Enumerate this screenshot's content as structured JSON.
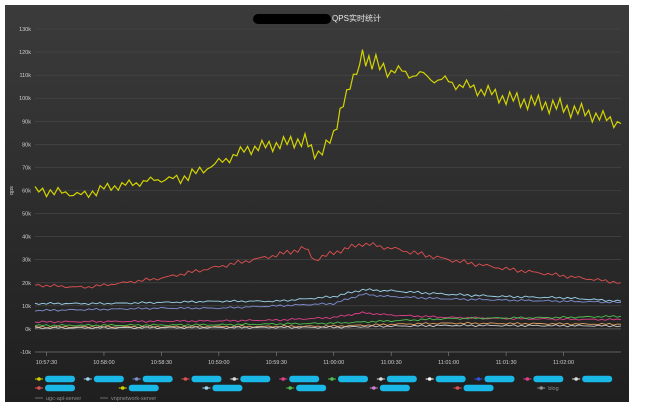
{
  "chart_data": {
    "type": "line",
    "title": "QPS实时统计",
    "ylabel": "qps",
    "ylim": [
      -10000,
      130000
    ],
    "y_ticks": [
      {
        "v": -10000,
        "label": "-10k"
      },
      {
        "v": 0,
        "label": "0k"
      },
      {
        "v": 10000,
        "label": "10k"
      },
      {
        "v": 20000,
        "label": "20k"
      },
      {
        "v": 30000,
        "label": "30k"
      },
      {
        "v": 40000,
        "label": "40k"
      },
      {
        "v": 50000,
        "label": "50k"
      },
      {
        "v": 60000,
        "label": "60k"
      },
      {
        "v": 70000,
        "label": "70k"
      },
      {
        "v": 80000,
        "label": "80k"
      },
      {
        "v": 90000,
        "label": "90k"
      },
      {
        "v": 100000,
        "label": "100k"
      },
      {
        "v": 110000,
        "label": "110k"
      },
      {
        "v": 120000,
        "label": "120k"
      },
      {
        "v": 130000,
        "label": "130k"
      }
    ],
    "x_ticks": [
      "10:57:30",
      "10:58:00",
      "10:58:30",
      "10:59:00",
      "10:59:30",
      "11:00:00",
      "11:00:30",
      "11:01:00",
      "11:01:30",
      "11:02:00"
    ],
    "xlim": [
      "10:57:24",
      "10:02:30"
    ],
    "grid": true,
    "legend": "bottom",
    "series": [
      {
        "color": "#d4d400",
        "x": [
          "10:57:24",
          "10:57:40",
          "10:57:50",
          "10:58:00",
          "10:58:15",
          "10:58:30",
          "10:58:40",
          "10:59:00",
          "10:59:15",
          "10:59:30",
          "10:59:45",
          "10:59:50",
          "11:00:00",
          "11:00:05",
          "11:00:12",
          "11:00:15",
          "11:00:20",
          "11:00:30",
          "11:00:45",
          "11:01:00",
          "11:01:15",
          "11:01:30",
          "11:01:45",
          "11:02:00",
          "11:02:15",
          "11:02:30"
        ],
        "values": [
          60000,
          59000,
          58000,
          61000,
          63000,
          65000,
          65000,
          72000,
          78000,
          80000,
          82000,
          75000,
          83000,
          100000,
          110000,
          120000,
          115000,
          112000,
          110000,
          107000,
          104000,
          100000,
          98000,
          96000,
          93000,
          89000
        ]
      },
      {
        "color": "#e05050",
        "x": [
          "10:57:24",
          "10:57:50",
          "10:58:00",
          "10:58:30",
          "10:59:00",
          "10:59:30",
          "10:59:45",
          "10:59:50",
          "11:00:00",
          "11:00:15",
          "11:00:30",
          "11:01:00",
          "11:01:30",
          "11:02:00",
          "11:02:30"
        ],
        "values": [
          19000,
          18000,
          19000,
          22000,
          27000,
          32000,
          35000,
          30000,
          33000,
          37000,
          35000,
          30000,
          26000,
          23000,
          20000
        ]
      },
      {
        "color": "#9fd6f0",
        "x": [
          "10:57:24",
          "10:58:00",
          "10:58:30",
          "10:59:00",
          "10:59:30",
          "11:00:00",
          "11:00:15",
          "11:00:30",
          "11:01:00",
          "11:01:30",
          "11:02:00",
          "11:02:30"
        ],
        "values": [
          11000,
          11000,
          11500,
          12000,
          12000,
          14000,
          17000,
          16500,
          15000,
          14000,
          13500,
          12000
        ]
      },
      {
        "color": "#7f8fd0",
        "x": [
          "10:57:24",
          "10:58:00",
          "10:58:30",
          "10:59:00",
          "10:59:30",
          "11:00:00",
          "11:00:15",
          "11:00:30",
          "11:01:00",
          "11:01:30",
          "11:02:00",
          "11:02:30"
        ],
        "values": [
          8000,
          8500,
          9000,
          9000,
          10000,
          11000,
          15000,
          14000,
          13000,
          12500,
          12000,
          11500
        ]
      },
      {
        "color": "#e0408a",
        "x": [
          "10:57:24",
          "10:58:00",
          "10:59:00",
          "10:59:30",
          "11:00:00",
          "11:00:15",
          "11:00:30",
          "11:01:00",
          "11:01:30",
          "11:02:00",
          "11:02:30"
        ],
        "values": [
          3000,
          3200,
          3500,
          3800,
          5000,
          7000,
          6000,
          5000,
          4500,
          4200,
          4000
        ]
      },
      {
        "color": "#50c050",
        "x": [
          "10:57:24",
          "10:58:00",
          "10:59:00",
          "11:00:00",
          "11:00:30",
          "11:01:00",
          "11:02:00",
          "11:02:30"
        ],
        "values": [
          1500,
          1600,
          1800,
          2500,
          3500,
          4500,
          5000,
          5500
        ]
      },
      {
        "color": "#e0a060",
        "x": [
          "10:57:24",
          "10:58:00",
          "10:59:00",
          "11:00:00",
          "11:00:30",
          "11:01:00",
          "11:02:00",
          "11:02:30"
        ],
        "values": [
          800,
          900,
          1000,
          1200,
          2000,
          2500,
          2200,
          2000
        ]
      },
      {
        "color": "#c8c8c8",
        "x": [
          "10:57:24",
          "10:58:00",
          "10:59:00",
          "11:00:00",
          "11:00:30",
          "11:01:00",
          "11:02:00",
          "11:02:30"
        ],
        "values": [
          400,
          500,
          600,
          700,
          1200,
          1500,
          1400,
          1300
        ]
      }
    ],
    "legend_items": [
      {
        "color": "#d4d400",
        "label": ""
      },
      {
        "color": "#9fd6f0",
        "label": ""
      },
      {
        "color": "#7f8fd0",
        "label": ""
      },
      {
        "color": "#e05050",
        "label": ""
      },
      {
        "color": "#e0e0e0",
        "label": ""
      },
      {
        "color": "#e0408a",
        "label": ""
      },
      {
        "color": "#50c050",
        "label": ""
      },
      {
        "color": "#e0e0e0",
        "label": ""
      },
      {
        "color": "#ffffff",
        "label": ""
      },
      {
        "color": "#3050e0",
        "label": ""
      },
      {
        "color": "#e0408a",
        "label": ""
      },
      {
        "color": "#e0e0e0",
        "label": ""
      },
      {
        "color": "#e05050",
        "label": ""
      },
      {
        "color": "#d4d400",
        "label": ""
      },
      {
        "color": "#9fd6f0",
        "label": ""
      },
      {
        "color": "#50c050",
        "label": ""
      },
      {
        "color": "#d080d0",
        "label": ""
      },
      {
        "color": "#e05050",
        "label": ""
      },
      {
        "color": "#8e8e8e",
        "label": "blog"
      }
    ],
    "legend_faint_labels": [
      "ugc-api-server",
      "vnpnetwork-server"
    ]
  }
}
